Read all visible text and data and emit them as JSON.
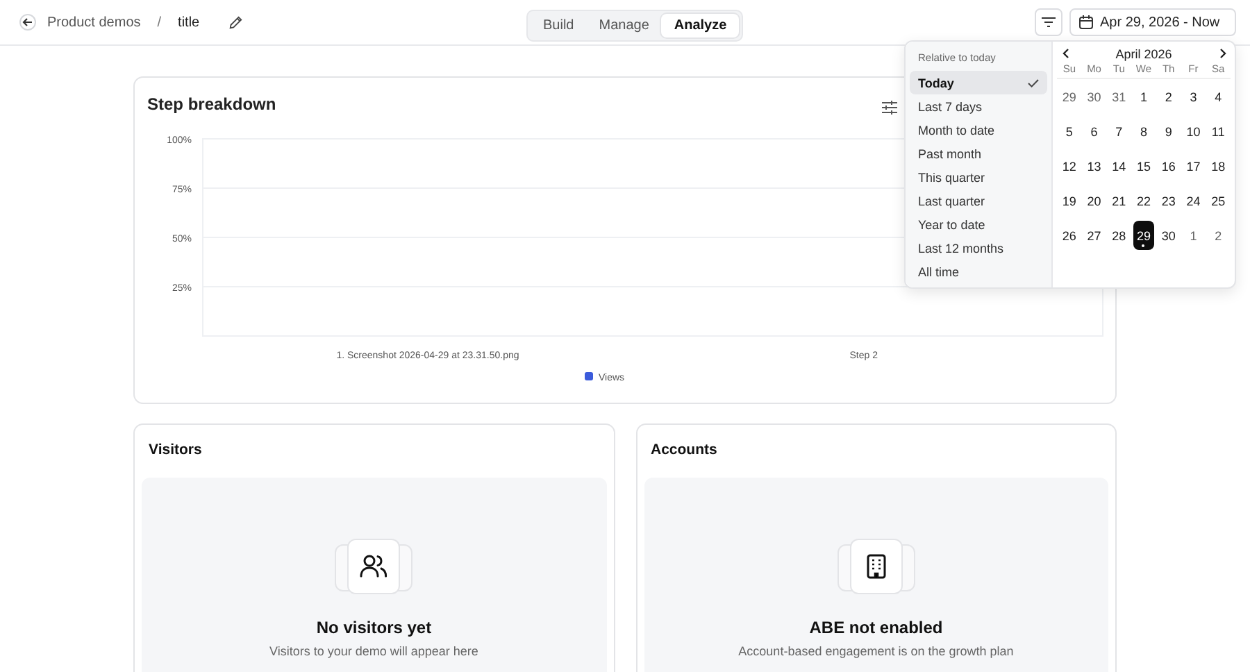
{
  "header": {
    "breadcrumb": "Product demos",
    "separator": "/",
    "title": "title",
    "tabs": [
      {
        "label": "Build",
        "selected": false
      },
      {
        "label": "Manage",
        "selected": false
      },
      {
        "label": "Analyze",
        "selected": true
      }
    ],
    "date_range": "Apr 29, 2026 - Now"
  },
  "date_picker": {
    "section_label": "Relative to today",
    "presets": [
      {
        "label": "Today",
        "selected": true
      },
      {
        "label": "Last 7 days",
        "selected": false
      },
      {
        "label": "Month to date",
        "selected": false
      },
      {
        "label": "Past month",
        "selected": false
      },
      {
        "label": "This quarter",
        "selected": false
      },
      {
        "label": "Last quarter",
        "selected": false
      },
      {
        "label": "Year to date",
        "selected": false
      },
      {
        "label": "Last 12 months",
        "selected": false
      },
      {
        "label": "All time",
        "selected": false
      }
    ],
    "month": "April 2026",
    "weekdays": [
      "Su",
      "Mo",
      "Tu",
      "We",
      "Th",
      "Fr",
      "Sa"
    ],
    "weeks": [
      [
        {
          "day": "29",
          "muted": true,
          "selected": false,
          "today": false
        },
        {
          "day": "30",
          "muted": true,
          "selected": false,
          "today": false
        },
        {
          "day": "31",
          "muted": true,
          "selected": false,
          "today": false
        },
        {
          "day": "1",
          "muted": false,
          "selected": false,
          "today": false
        },
        {
          "day": "2",
          "muted": false,
          "selected": false,
          "today": false
        },
        {
          "day": "3",
          "muted": false,
          "selected": false,
          "today": false
        },
        {
          "day": "4",
          "muted": false,
          "selected": false,
          "today": false
        }
      ],
      [
        {
          "day": "5",
          "muted": false,
          "selected": false,
          "today": false
        },
        {
          "day": "6",
          "muted": false,
          "selected": false,
          "today": false
        },
        {
          "day": "7",
          "muted": false,
          "selected": false,
          "today": false
        },
        {
          "day": "8",
          "muted": false,
          "selected": false,
          "today": false
        },
        {
          "day": "9",
          "muted": false,
          "selected": false,
          "today": false
        },
        {
          "day": "10",
          "muted": false,
          "selected": false,
          "today": false
        },
        {
          "day": "11",
          "muted": false,
          "selected": false,
          "today": false
        }
      ],
      [
        {
          "day": "12",
          "muted": false,
          "selected": false,
          "today": false
        },
        {
          "day": "13",
          "muted": false,
          "selected": false,
          "today": false
        },
        {
          "day": "14",
          "muted": false,
          "selected": false,
          "today": false
        },
        {
          "day": "15",
          "muted": false,
          "selected": false,
          "today": false
        },
        {
          "day": "16",
          "muted": false,
          "selected": false,
          "today": false
        },
        {
          "day": "17",
          "muted": false,
          "selected": false,
          "today": false
        },
        {
          "day": "18",
          "muted": false,
          "selected": false,
          "today": false
        }
      ],
      [
        {
          "day": "19",
          "muted": false,
          "selected": false,
          "today": false
        },
        {
          "day": "20",
          "muted": false,
          "selected": false,
          "today": false
        },
        {
          "day": "21",
          "muted": false,
          "selected": false,
          "today": false
        },
        {
          "day": "22",
          "muted": false,
          "selected": false,
          "today": false
        },
        {
          "day": "23",
          "muted": false,
          "selected": false,
          "today": false
        },
        {
          "day": "24",
          "muted": false,
          "selected": false,
          "today": false
        },
        {
          "day": "25",
          "muted": false,
          "selected": false,
          "today": false
        }
      ],
      [
        {
          "day": "26",
          "muted": false,
          "selected": false,
          "today": false
        },
        {
          "day": "27",
          "muted": false,
          "selected": false,
          "today": false
        },
        {
          "day": "28",
          "muted": false,
          "selected": false,
          "today": false
        },
        {
          "day": "29",
          "muted": false,
          "selected": true,
          "today": true
        },
        {
          "day": "30",
          "muted": false,
          "selected": false,
          "today": false
        },
        {
          "day": "1",
          "muted": true,
          "selected": false,
          "today": false
        },
        {
          "day": "2",
          "muted": true,
          "selected": false,
          "today": false
        }
      ]
    ]
  },
  "step_breakdown": {
    "title": "Step breakdown",
    "chart_data": {
      "type": "bar",
      "categories": [
        "1. Screenshot 2026-04-29 at 23.31.50.png",
        "Step 2"
      ],
      "series": [
        {
          "name": "Views",
          "color": "#3b5bdb",
          "values": [
            null,
            null
          ]
        }
      ],
      "ylim": [
        0,
        100
      ],
      "grid": true,
      "yticks": [
        {
          "value": 25,
          "label": "25%"
        },
        {
          "value": 50,
          "label": "50%"
        },
        {
          "value": 75,
          "label": "75%"
        },
        {
          "value": 100,
          "label": "100%"
        }
      ]
    }
  },
  "panels": [
    {
      "kind": "people",
      "title": "Visitors",
      "empty_title": "No visitors yet",
      "empty_text": "Visitors to your demo will appear here"
    },
    {
      "kind": "building",
      "title": "Accounts",
      "empty_title": "ABE not enabled",
      "empty_text": "Account-based engagement is on the growth plan"
    }
  ]
}
